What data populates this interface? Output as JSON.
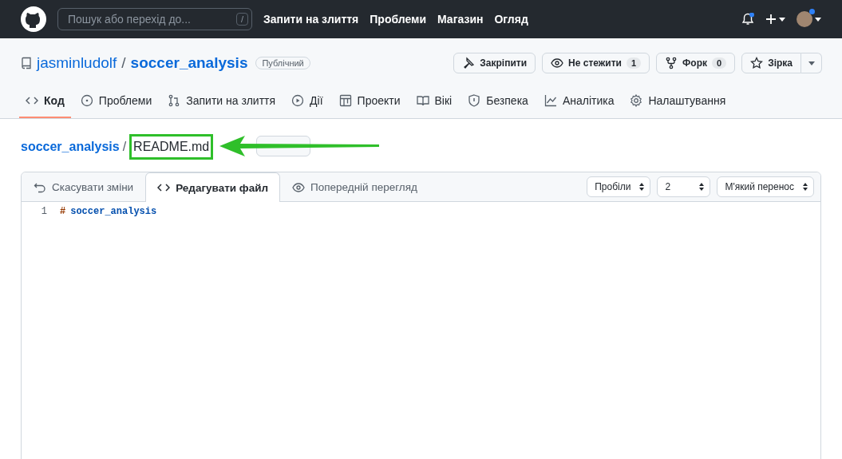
{
  "header": {
    "search": {
      "placeholder": "Пошук або перехід до...",
      "shortcut": "/"
    },
    "nav": [
      "Запити на злиття",
      "Проблеми",
      "Магазин",
      "Огляд"
    ]
  },
  "repo": {
    "owner": "jasminludolf",
    "separator": "/",
    "name": "soccer_analysis",
    "visibility": "Публічний",
    "actions": [
      {
        "kind": "pin",
        "label": "Закріпити"
      },
      {
        "kind": "watch",
        "label": "Не стежити",
        "count": "1"
      },
      {
        "kind": "fork",
        "label": "Форк",
        "count": "0"
      },
      {
        "kind": "star",
        "label": "Зірка"
      }
    ]
  },
  "tabs": [
    {
      "kind": "code",
      "label": "Код",
      "selected": true
    },
    {
      "kind": "issues",
      "label": "Проблеми",
      "selected": false
    },
    {
      "kind": "pulls",
      "label": "Запити на злиття",
      "selected": false
    },
    {
      "kind": "actions",
      "label": "Дії",
      "selected": false
    },
    {
      "kind": "projects",
      "label": "Проекти",
      "selected": false
    },
    {
      "kind": "wiki",
      "label": "Вікі",
      "selected": false
    },
    {
      "kind": "security",
      "label": "Безпека",
      "selected": false
    },
    {
      "kind": "insights",
      "label": "Аналітика",
      "selected": false
    },
    {
      "kind": "settings",
      "label": "Налаштування",
      "selected": false
    }
  ],
  "breadcrumb": {
    "repo": "soccer_analysis",
    "separator": "/",
    "file": "README.md"
  },
  "editor": {
    "tabs": [
      {
        "kind": "undo",
        "label": "Скасувати зміни",
        "selected": false
      },
      {
        "kind": "code",
        "label": "Редагувати файл",
        "selected": true
      },
      {
        "kind": "preview",
        "label": "Попередній перегляд",
        "selected": false
      }
    ],
    "selects": [
      "Пробіли",
      "2",
      "М'який перенос"
    ],
    "lines": [
      {
        "number": "1",
        "marker": "#",
        "text": "soccer_analysis"
      }
    ]
  }
}
